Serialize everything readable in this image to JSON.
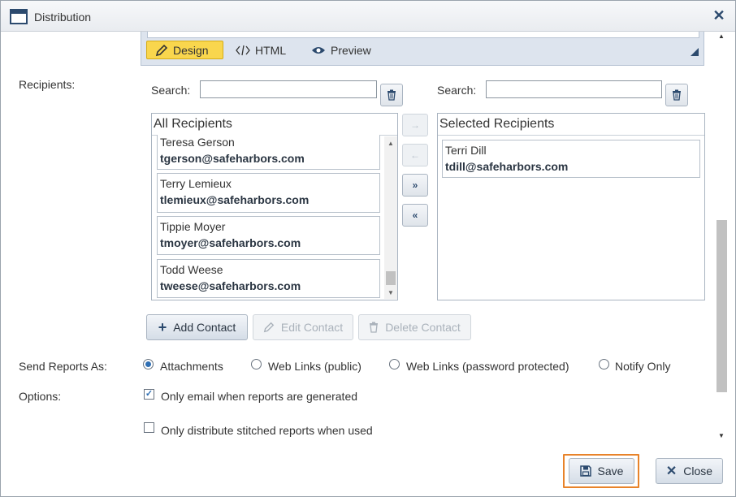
{
  "window": {
    "title": "Distribution",
    "close_icon": "close-icon"
  },
  "editor": {
    "modes": [
      {
        "label": "Design",
        "icon": "pencil-icon",
        "active": true
      },
      {
        "label": "HTML",
        "icon": "code-icon",
        "active": false
      },
      {
        "label": "Preview",
        "icon": "eye-icon",
        "active": false
      }
    ]
  },
  "recipients": {
    "label": "Recipients:",
    "left_search_label": "Search:",
    "left_search_value": "",
    "right_search_label": "Search:",
    "right_search_value": "",
    "all_header": "All Recipients",
    "selected_header": "Selected Recipients",
    "all": [
      {
        "name": "Teresa Gerson",
        "email": "tgerson@safeharbors.com"
      },
      {
        "name": "Terry Lemieux",
        "email": "tlemieux@safeharbors.com"
      },
      {
        "name": "Tippie Moyer",
        "email": "tmoyer@safeharbors.com"
      },
      {
        "name": "Todd Weese",
        "email": "tweese@safeharbors.com"
      }
    ],
    "selected": [
      {
        "name": "Terri Dill",
        "email": "tdill@safeharbors.com"
      }
    ],
    "move_buttons": [
      "→",
      "←",
      "»",
      "«"
    ]
  },
  "contact_actions": {
    "add": "Add Contact",
    "edit": "Edit Contact",
    "delete": "Delete Contact"
  },
  "send_reports": {
    "label": "Send Reports As:",
    "options": [
      "Attachments",
      "Web Links (public)",
      "Web Links (password protected)",
      "Notify Only"
    ],
    "selected": "Attachments"
  },
  "options": {
    "label": "Options:",
    "only_email": {
      "label": "Only email when reports are generated",
      "checked": true
    },
    "only_stitched": {
      "label": "Only distribute stitched reports when used",
      "checked": false
    }
  },
  "footer": {
    "save": "Save",
    "close": "Close"
  },
  "colors": {
    "accent": "#f9d64d",
    "highlight": "#e8832a",
    "primary": "#2c4a6e"
  }
}
